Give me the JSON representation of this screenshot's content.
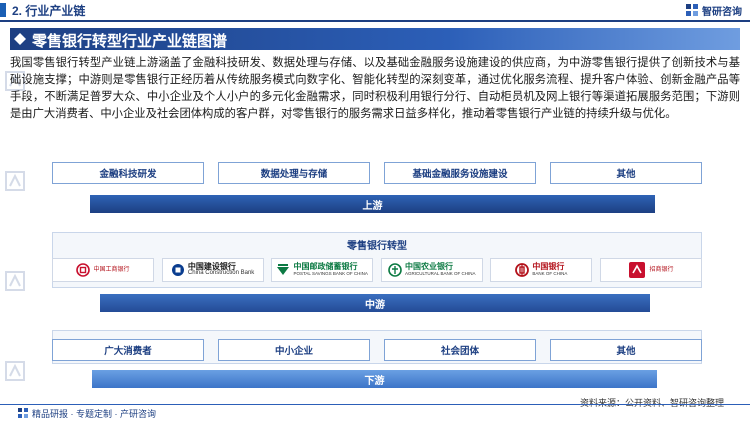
{
  "header": {
    "section_title": "2. 行业产业链",
    "brand_name": "智研咨询"
  },
  "banner": {
    "title": "零售银行转型行业产业链图谱"
  },
  "description": "我国零售银行转型产业链上游涵盖了金融科技研发、数据处理与存储、以及基础金融服务设施建设的供应商，为中游零售银行提供了创新技术与基础设施支撑；中游则是零售银行正经历着从传统服务模式向数字化、智能化转型的深刻变革，通过优化服务流程、提升客户体验、创新金融产品等手段，不断满足普罗大众、中小企业及个人小户的多元化金融需求，同时积极利用银行分行、自动柜员机及网上银行等渠道拓展服务范围；下游则是由广大消费者、中小企业及社会团体构成的客户群，对零售银行的服务需求日益多样化，推动着零售银行产业链的持续升级与优化。",
  "upstream": {
    "items": [
      "金融科技研发",
      "数据处理与存储",
      "基础金融服务设施建设",
      "其他"
    ],
    "label": "上游"
  },
  "midstream": {
    "panel_title": "零售银行转型",
    "banks": [
      {
        "name_cn": "中国工商银行",
        "name_en": ""
      },
      {
        "name_cn": "中国建设银行",
        "name_en": "China Construction Bank"
      },
      {
        "name_cn": "中国邮政储蓄银行",
        "name_en": "POSTAL SAVINGS BANK OF CHINA"
      },
      {
        "name_cn": "中国农业银行",
        "name_en": "AGRICULTURAL BANK OF CHINA"
      },
      {
        "name_cn": "中国银行",
        "name_en": "BANK OF CHINA"
      },
      {
        "name_cn": "招商银行",
        "name_en": ""
      }
    ],
    "label": "中游"
  },
  "downstream": {
    "items": [
      "广大消费者",
      "中小企业",
      "社会团体",
      "其他"
    ],
    "label": "下游"
  },
  "source": "资料来源：公开资料、智研咨询整理",
  "footer": {
    "slogan": "精品研报 · 专题定制 · 产研咨询"
  },
  "colors": {
    "primary": "#1d3f82",
    "accent": "#2c5fb8",
    "icbc_red": "#c8102e",
    "ccb_blue": "#0a3d8f",
    "psbc_green": "#0c7a43",
    "abc_green": "#0c7a43",
    "boc_red": "#b3121b",
    "cmb_red": "#c8102e"
  }
}
